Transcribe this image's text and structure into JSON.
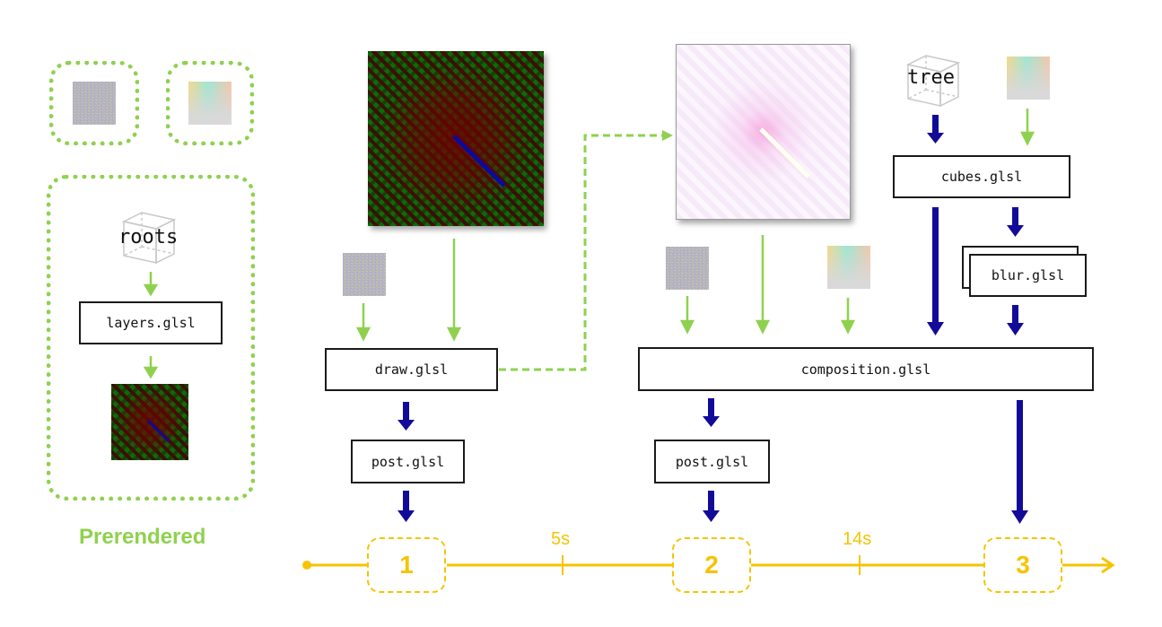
{
  "colors": {
    "green_arrow": "#8fd14f",
    "blue_arrow": "#120b99",
    "timeline": "#f5c400",
    "box_border": "#1a1a1a"
  },
  "prerendered": {
    "label": "Prerendered",
    "textures": [
      {
        "kind": "noise-texture"
      },
      {
        "kind": "gradient-texture"
      }
    ],
    "pipeline": {
      "model": "roots",
      "shader": "layers.glsl",
      "output": "pattern-texture"
    }
  },
  "stage1": {
    "inputs": [
      "noise-texture",
      "pattern-texture"
    ],
    "shader": "draw.glsl",
    "post": "post.glsl",
    "step": "1"
  },
  "stage2": {
    "inputs": [
      "noise-texture",
      "draw-output-texture",
      "gradient-texture",
      "cubes-output",
      "blur-output"
    ],
    "shader": "composition.glsl",
    "post": "post.glsl",
    "step": "2"
  },
  "stage3": {
    "model": "tree",
    "shader": "cubes.glsl",
    "blur": "blur.glsl",
    "step": "3"
  },
  "timeline": {
    "ticks": [
      {
        "label": "5s"
      },
      {
        "label": "14s"
      }
    ],
    "steps": [
      "1",
      "2",
      "3"
    ]
  }
}
